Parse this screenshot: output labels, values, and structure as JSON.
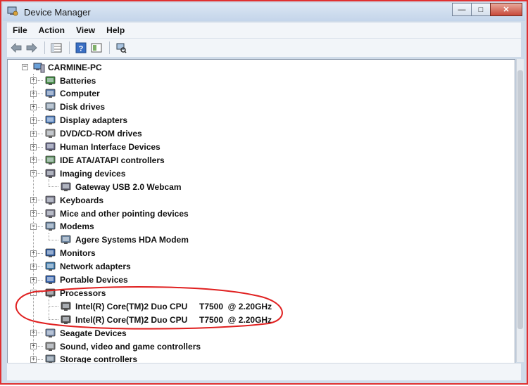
{
  "window": {
    "title": "Device Manager",
    "minimize": "—",
    "maximize": "□",
    "close": "✕"
  },
  "menu": [
    "File",
    "Action",
    "View",
    "Help"
  ],
  "toolbar": [
    "back-icon",
    "forward-icon",
    "properties-grid-icon",
    "help-icon",
    "view-icon",
    "scan-hardware-icon"
  ],
  "tree": {
    "root": "CARMINE-PC",
    "categories": [
      {
        "label": "Batteries",
        "expanded": false,
        "icon": "battery-icon"
      },
      {
        "label": "Computer",
        "expanded": false,
        "icon": "computer-icon"
      },
      {
        "label": "Disk drives",
        "expanded": false,
        "icon": "disk-drive-icon"
      },
      {
        "label": "Display adapters",
        "expanded": false,
        "icon": "display-adapter-icon"
      },
      {
        "label": "DVD/CD-ROM drives",
        "expanded": false,
        "icon": "dvd-drive-icon"
      },
      {
        "label": "Human Interface Devices",
        "expanded": false,
        "icon": "hid-icon"
      },
      {
        "label": "IDE ATA/ATAPI controllers",
        "expanded": false,
        "icon": "ide-controller-icon"
      },
      {
        "label": "Imaging devices",
        "expanded": true,
        "icon": "camera-icon",
        "children": [
          "Gateway USB 2.0 Webcam"
        ]
      },
      {
        "label": "Keyboards",
        "expanded": false,
        "icon": "keyboard-icon"
      },
      {
        "label": "Mice and other pointing devices",
        "expanded": false,
        "icon": "mouse-icon"
      },
      {
        "label": "Modems",
        "expanded": true,
        "icon": "modem-icon",
        "children": [
          "Agere Systems HDA Modem"
        ]
      },
      {
        "label": "Monitors",
        "expanded": false,
        "icon": "monitor-icon"
      },
      {
        "label": "Network adapters",
        "expanded": false,
        "icon": "network-adapter-icon"
      },
      {
        "label": "Portable Devices",
        "expanded": false,
        "icon": "portable-device-icon"
      },
      {
        "label": "Processors",
        "expanded": true,
        "icon": "processor-icon",
        "children": [
          "Intel(R) Core(TM)2 Duo CPU     T7500  @ 2.20GHz",
          "Intel(R) Core(TM)2 Duo CPU     T7500  @ 2.20GHz"
        ]
      },
      {
        "label": "Seagate Devices",
        "expanded": false,
        "icon": "seagate-icon"
      },
      {
        "label": "Sound, video and game controllers",
        "expanded": false,
        "icon": "speaker-icon"
      },
      {
        "label": "Storage controllers",
        "expanded": false,
        "icon": "storage-controller-icon"
      }
    ]
  },
  "colors": {
    "annotation": "#e02020",
    "window_border": "#e03030"
  }
}
